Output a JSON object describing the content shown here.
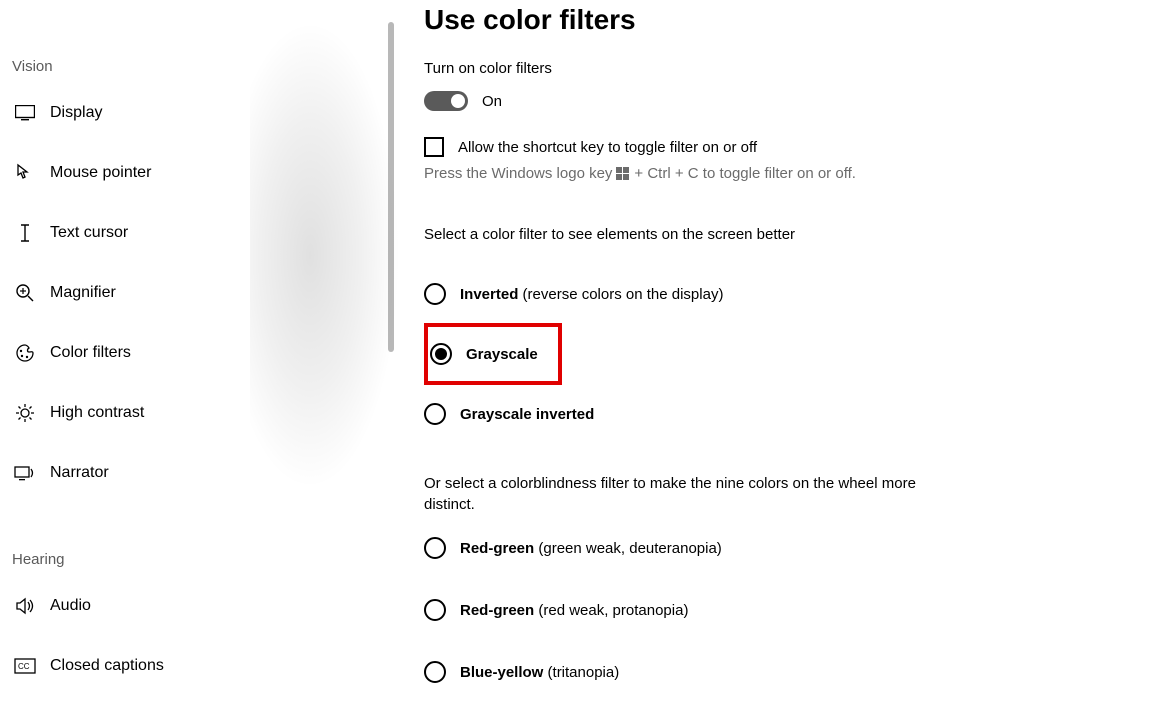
{
  "sidebar": {
    "group1": "Vision",
    "group2": "Hearing",
    "items": [
      {
        "label": "Display"
      },
      {
        "label": "Mouse pointer"
      },
      {
        "label": "Text cursor"
      },
      {
        "label": "Magnifier"
      },
      {
        "label": "Color filters"
      },
      {
        "label": "High contrast"
      },
      {
        "label": "Narrator"
      }
    ],
    "hearing_items": [
      {
        "label": "Audio"
      },
      {
        "label": "Closed captions"
      }
    ]
  },
  "main": {
    "title": "Use color filters",
    "toggle_label": "Turn on color filters",
    "toggle_state": "On",
    "shortcut_allow": "Allow the shortcut key to toggle filter on or off",
    "shortcut_hint_a": "Press the Windows logo key ",
    "shortcut_hint_b": " + Ctrl + C to toggle filter on or off.",
    "select_filter": "Select a color filter to see elements on the screen better",
    "filters": [
      {
        "bold": "Inverted",
        "rest": " (reverse colors on the display)"
      },
      {
        "bold": "Grayscale",
        "rest": ""
      },
      {
        "bold": "Grayscale inverted",
        "rest": ""
      }
    ],
    "cb_desc": "Or select a colorblindness filter to make the nine colors on the wheel more distinct.",
    "cb_filters": [
      {
        "bold": "Red-green",
        "rest": " (green weak, deuteranopia)"
      },
      {
        "bold": "Red-green",
        "rest": " (red weak, protanopia)"
      },
      {
        "bold": "Blue-yellow",
        "rest": " (tritanopia)"
      }
    ]
  }
}
